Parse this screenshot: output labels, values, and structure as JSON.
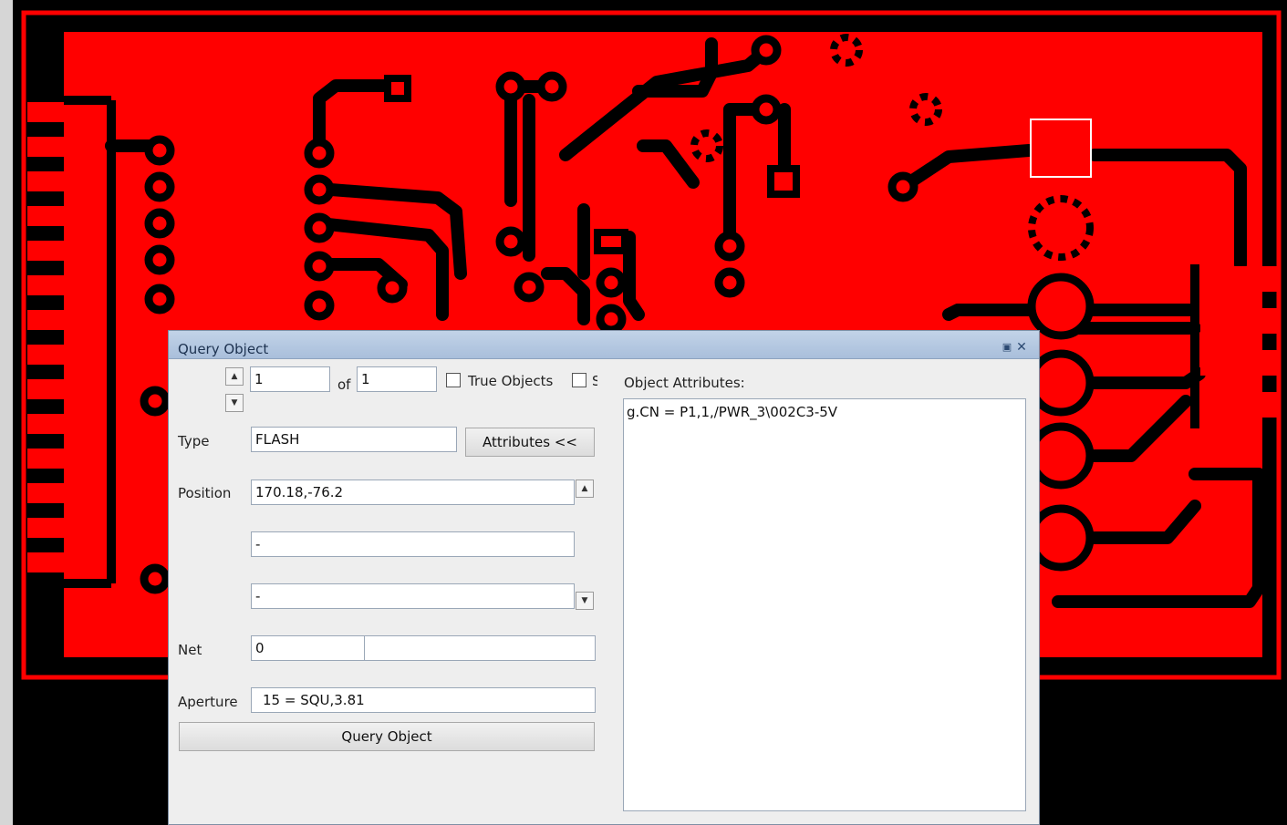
{
  "colors": {
    "copper": "#ff0000",
    "background": "#000000",
    "highlight": "#ffffff"
  },
  "dialog": {
    "title": "Query Object",
    "restore_icon": "restore-icon",
    "close_icon": "close-icon",
    "index_value": "1",
    "of_label": "of",
    "total_value": "1",
    "true_objects_label": "True Objects",
    "second_checkbox_label": "S",
    "type_label": "Type",
    "type_value": "FLASH",
    "attributes_button": "Attributes <<",
    "position_label": "Position",
    "position_value": "170.18,-76.2",
    "position_line2": "-",
    "position_line3": "-",
    "net_label": "Net",
    "net_value": "0",
    "net_name": "",
    "aperture_label": "Aperture",
    "aperture_value": "15 = SQU,3.81",
    "query_button": "Query Object",
    "object_attributes_label": "Object Attributes:",
    "object_attributes_text": "g.CN = P1,1,/PWR_3\\002C3-5V"
  }
}
